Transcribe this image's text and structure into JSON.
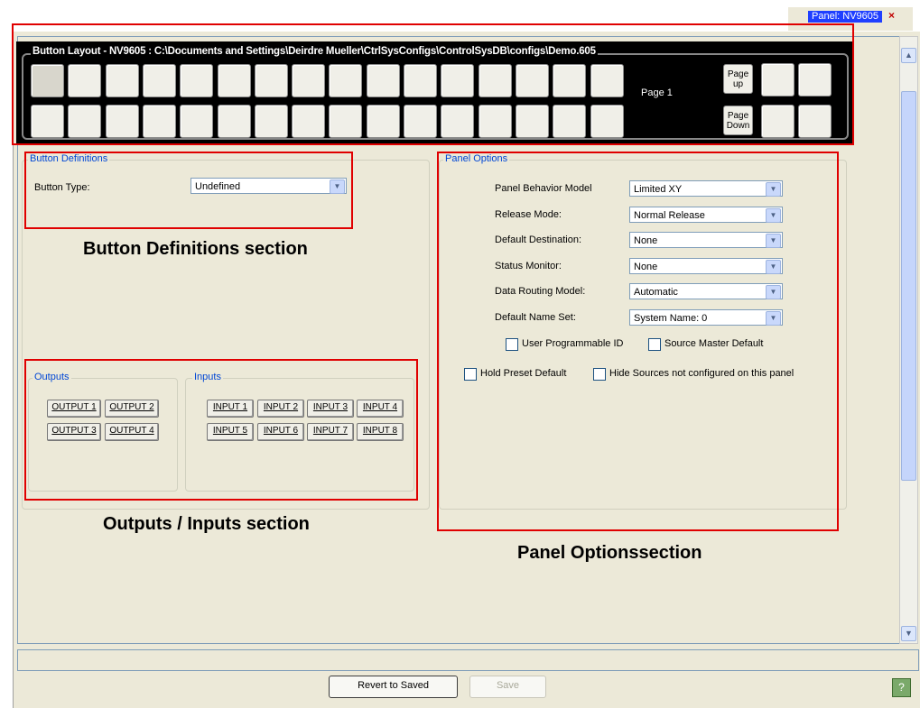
{
  "tab": {
    "label": "Panel: NV9605",
    "close": "×"
  },
  "layout": {
    "title": "Button Layout - NV9605 : C:\\Documents and Settings\\Deirdre Mueller\\CtrlSysConfigs\\ControlSysDB\\configs\\Demo.605",
    "page_label": "Page 1",
    "page_up_label": "Page up",
    "page_down_label": "Page Down"
  },
  "button_definitions": {
    "title": "Button Definitions",
    "button_type_label": "Button Type:",
    "button_type_value": "Undefined"
  },
  "outputs": {
    "title": "Outputs",
    "buttons": [
      "OUTPUT 1",
      "OUTPUT 2",
      "OUTPUT 3",
      "OUTPUT 4"
    ]
  },
  "inputs": {
    "title": "Inputs",
    "buttons": [
      "INPUT 1",
      "INPUT 2",
      "INPUT 3",
      "INPUT 4",
      "INPUT 5",
      "INPUT 6",
      "INPUT 7",
      "INPUT 8"
    ]
  },
  "panel_options": {
    "title": "Panel Options",
    "fields": [
      {
        "label": "Panel Behavior Model",
        "value": "Limited XY"
      },
      {
        "label": "Release Mode:",
        "value": "Normal Release"
      },
      {
        "label": "Default Destination:",
        "value": "None"
      },
      {
        "label": "Status Monitor:",
        "value": "None"
      },
      {
        "label": "Data Routing Model:",
        "value": "Automatic"
      },
      {
        "label": "Default Name Set:",
        "value": "System Name: 0"
      }
    ],
    "checkboxes": {
      "user_programmable_id": "User Programmable ID",
      "source_master_default": "Source Master Default",
      "hold_preset_default": "Hold Preset Default",
      "hide_sources": "Hide Sources not configured on this panel"
    }
  },
  "annotations": {
    "button_definitions": "Button Definitions section",
    "outputs_inputs": "Outputs / Inputs section",
    "panel_options": "Panel Optionssection"
  },
  "footer": {
    "revert_label": "Revert to Saved",
    "save_label": "Save",
    "help_icon": "?"
  },
  "colors": {
    "annotation_red": "#e00000",
    "group_title_blue": "#0046d5",
    "window_bg": "#ece9d8"
  }
}
